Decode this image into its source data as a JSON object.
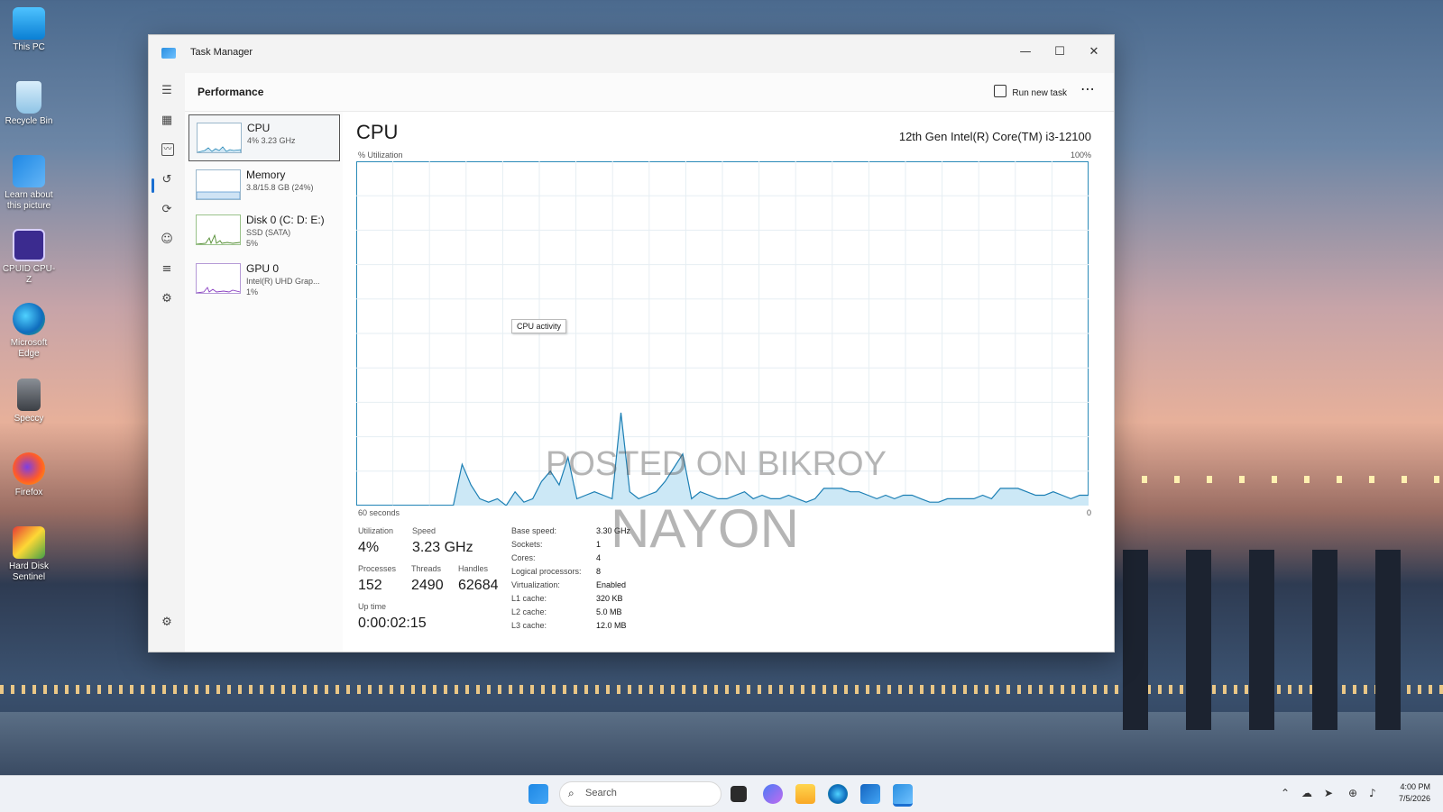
{
  "desktop": {
    "icons": [
      {
        "label": "This PC"
      },
      {
        "label": "Recycle Bin"
      },
      {
        "label": "Learn about this picture"
      },
      {
        "label": "CPUID CPU-Z"
      },
      {
        "label": "Microsoft Edge"
      },
      {
        "label": "Speccy"
      },
      {
        "label": "Firefox"
      },
      {
        "label": "Hard Disk Sentinel"
      }
    ]
  },
  "window": {
    "title": "Task Manager",
    "minimize": "—",
    "maximize": "☐",
    "close": "✕"
  },
  "header": {
    "title": "Performance",
    "run_new_task": "Run new task",
    "more": "⋯"
  },
  "devices": [
    {
      "name": "CPU",
      "sub": "4% 3.23 GHz"
    },
    {
      "name": "Memory",
      "sub": "3.8/15.8 GB (24%)"
    },
    {
      "name": "Disk 0 (C: D: E:)",
      "sub": "SSD (SATA)",
      "sub2": "5%"
    },
    {
      "name": "GPU 0",
      "sub": "Intel(R) UHD Grap...",
      "sub2": "1%"
    }
  ],
  "cpu": {
    "title": "CPU",
    "model": "12th Gen Intel(R) Core(TM) i3-12100",
    "util_label": "% Utilization",
    "max_label": "100%",
    "time_label": "60 seconds",
    "zero_label": "0",
    "tooltip": "CPU activity"
  },
  "chart_data": {
    "type": "area",
    "title": "",
    "xlabel": "60 seconds",
    "ylabel": "% Utilization",
    "ylim": [
      0,
      100
    ],
    "xlim": [
      60,
      0
    ],
    "series": [
      {
        "values": [
          0,
          0,
          0,
          0,
          0,
          0,
          0,
          0,
          0,
          0,
          0,
          0,
          12,
          6,
          2,
          1,
          2,
          0,
          4,
          1,
          2,
          7,
          10,
          6,
          14,
          2,
          3,
          4,
          3,
          2,
          27,
          4,
          2,
          3,
          4,
          7,
          11,
          15,
          2,
          4,
          3,
          2,
          2,
          3,
          4,
          2,
          3,
          2,
          2,
          3,
          2,
          1,
          2,
          5,
          5,
          5,
          4,
          4,
          3,
          2,
          3,
          2,
          3,
          3,
          2,
          1,
          1,
          2,
          2,
          2,
          2,
          3,
          2,
          5,
          5,
          5,
          4,
          3,
          3,
          4,
          3,
          2,
          3,
          3
        ]
      }
    ]
  },
  "stats": {
    "utilization_label": "Utilization",
    "utilization": "4%",
    "speed_label": "Speed",
    "speed": "3.23 GHz",
    "processes_label": "Processes",
    "processes": "152",
    "threads_label": "Threads",
    "threads": "2490",
    "handles_label": "Handles",
    "handles": "62684",
    "uptime_label": "Up time",
    "uptime": "0:00:02:15"
  },
  "specs": [
    {
      "label": "Base speed:",
      "value": "3.30 GHz"
    },
    {
      "label": "Sockets:",
      "value": "1"
    },
    {
      "label": "Cores:",
      "value": "4"
    },
    {
      "label": "Logical processors:",
      "value": "8"
    },
    {
      "label": "Virtualization:",
      "value": "Enabled"
    },
    {
      "label": "L1 cache:",
      "value": "320 KB"
    },
    {
      "label": "L2 cache:",
      "value": "5.0 MB"
    },
    {
      "label": "L3 cache:",
      "value": "12.0 MB"
    }
  ],
  "watermark": {
    "line1": "POSTED ON BIKROY",
    "line2": "NAYON"
  },
  "taskbar": {
    "search_placeholder": "Search",
    "time": "4:00 PM",
    "date": "7/5/2026"
  }
}
